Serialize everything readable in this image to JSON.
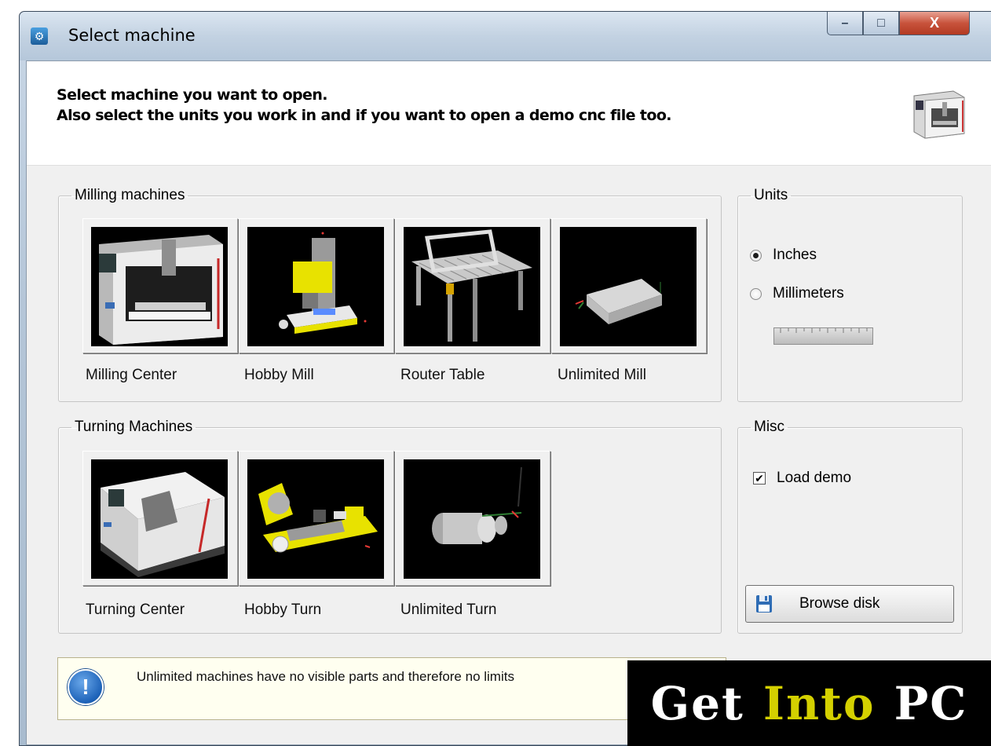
{
  "window": {
    "title": "Select machine",
    "controls": {
      "minimize": "–",
      "maximize": "□",
      "close": "X"
    }
  },
  "header": {
    "line1": "Select machine you want to open.",
    "line2": "Also select the units you work in and if you want to open a demo cnc file too."
  },
  "milling": {
    "legend": "Milling machines",
    "items": [
      {
        "label": "Milling Center"
      },
      {
        "label": "Hobby Mill"
      },
      {
        "label": "Router Table"
      },
      {
        "label": "Unlimited Mill"
      }
    ]
  },
  "turning": {
    "legend": "Turning Machines",
    "items": [
      {
        "label": "Turning Center"
      },
      {
        "label": "Hobby Turn"
      },
      {
        "label": "Unlimited Turn"
      }
    ]
  },
  "units": {
    "legend": "Units",
    "options": [
      {
        "label": "Inches",
        "selected": true
      },
      {
        "label": "Millimeters",
        "selected": false
      }
    ]
  },
  "misc": {
    "legend": "Misc",
    "load_demo_label": "Load demo",
    "load_demo_checked": true,
    "browse_label": "Browse disk"
  },
  "info": {
    "text": "Unlimited machines have no visible parts and therefore no limits"
  },
  "watermark": {
    "get": "Get",
    "into": "Into",
    "pc": "PC"
  },
  "colors": {
    "titlebar": "#c3d2e2",
    "close": "#c8533c",
    "info_bg": "#fffff0",
    "watermark_yellow": "#d4d000"
  }
}
